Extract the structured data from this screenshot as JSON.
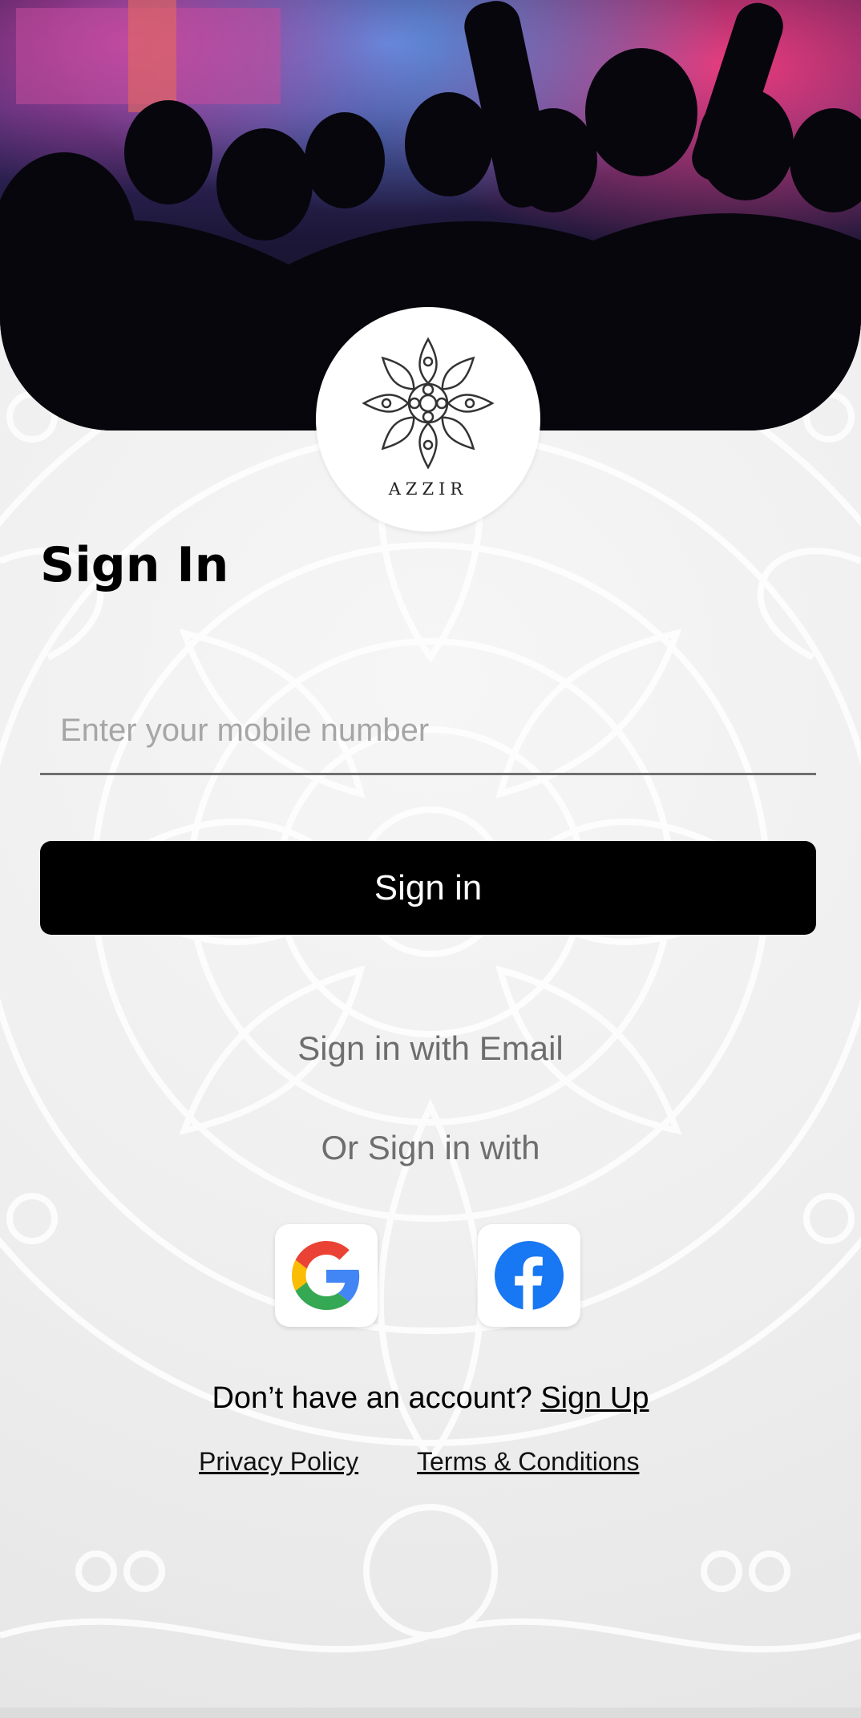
{
  "hero": {
    "image_name": "concert-crowd-photo"
  },
  "logo": {
    "icon": "mandala-flower-icon",
    "text": "AZZIR"
  },
  "title": "Sign In",
  "phone_input": {
    "placeholder": "Enter your mobile number",
    "value": ""
  },
  "signin_button": {
    "label": "Sign in"
  },
  "email_link": "Sign in with Email",
  "or_text": "Or Sign in with",
  "social": [
    {
      "name": "Google",
      "icon": "google-icon"
    },
    {
      "name": "Facebook",
      "icon": "facebook-icon"
    }
  ],
  "account": {
    "prompt": "Don’t have an account? ",
    "signup_label": "Sign Up"
  },
  "footer": {
    "privacy": "Privacy Policy",
    "terms": "Terms & Conditions"
  },
  "colors": {
    "primary": "#000000",
    "secondary_text": "#6e6e6e",
    "facebook_blue": "#1877F2",
    "background": "#eeeeee"
  }
}
